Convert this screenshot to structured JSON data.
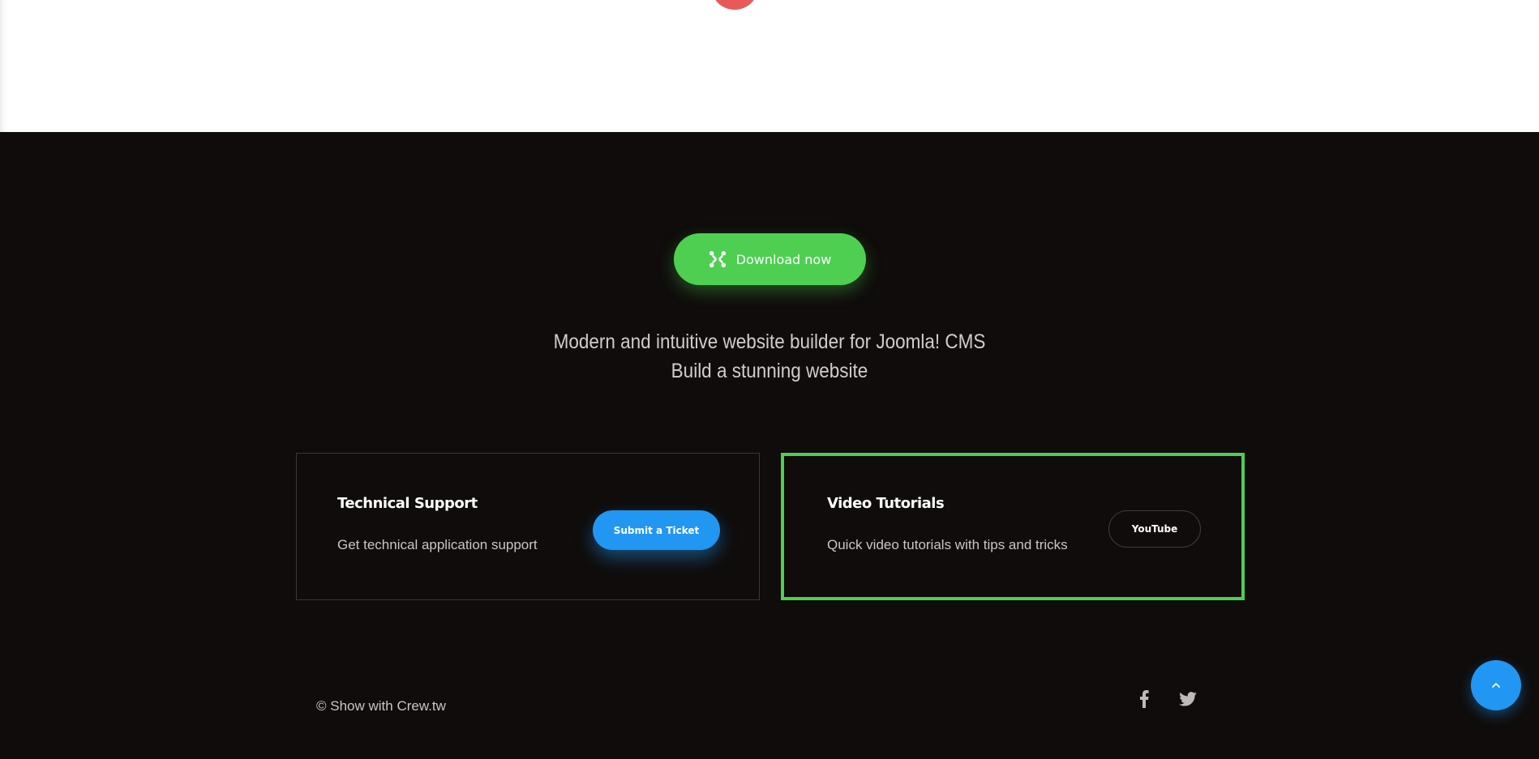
{
  "hero": {
    "download_label": "Download now",
    "tagline_line1": "Modern and intuitive website builder for Joomla! CMS",
    "tagline_line2": "Build a stunning website"
  },
  "support_card": {
    "title": "Technical Support",
    "description": "Get technical application support",
    "button_label": "Submit a Ticket"
  },
  "video_card": {
    "title": "Video Tutorials",
    "description": "Quick video tutorials with tips and tricks",
    "button_label": "YouTube"
  },
  "footer": {
    "copyright": "© Show with Crew.tw"
  },
  "icons": {
    "download": "joomla-icon",
    "facebook": "facebook-icon",
    "twitter": "twitter-icon",
    "back_to_top": "chevron-up-icon"
  },
  "colors": {
    "accent_green": "#4ecf51",
    "accent_blue": "#2196f3",
    "accent_red": "#e85a5a",
    "background_dark": "#0f0c0b"
  }
}
